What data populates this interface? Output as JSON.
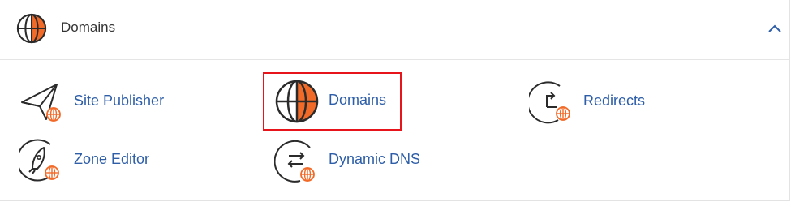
{
  "header": {
    "title": "Domains",
    "icon": "globe-icon",
    "collapse_icon": "chevron-up-icon"
  },
  "items": [
    {
      "label": "Site Publisher",
      "icon": "paper-plane-globe-icon"
    },
    {
      "label": "Domains",
      "icon": "globe-icon",
      "highlighted": true
    },
    {
      "label": "Redirects",
      "icon": "redirect-globe-icon"
    },
    {
      "label": "Zone Editor",
      "icon": "rocket-globe-icon"
    },
    {
      "label": "Dynamic DNS",
      "icon": "swap-arrows-globe-icon"
    }
  ],
  "colors": {
    "accent": "#f26a28",
    "link": "#2e5ea8",
    "icon_stroke": "#2b2b2b",
    "highlight_border": "#e8141b"
  }
}
